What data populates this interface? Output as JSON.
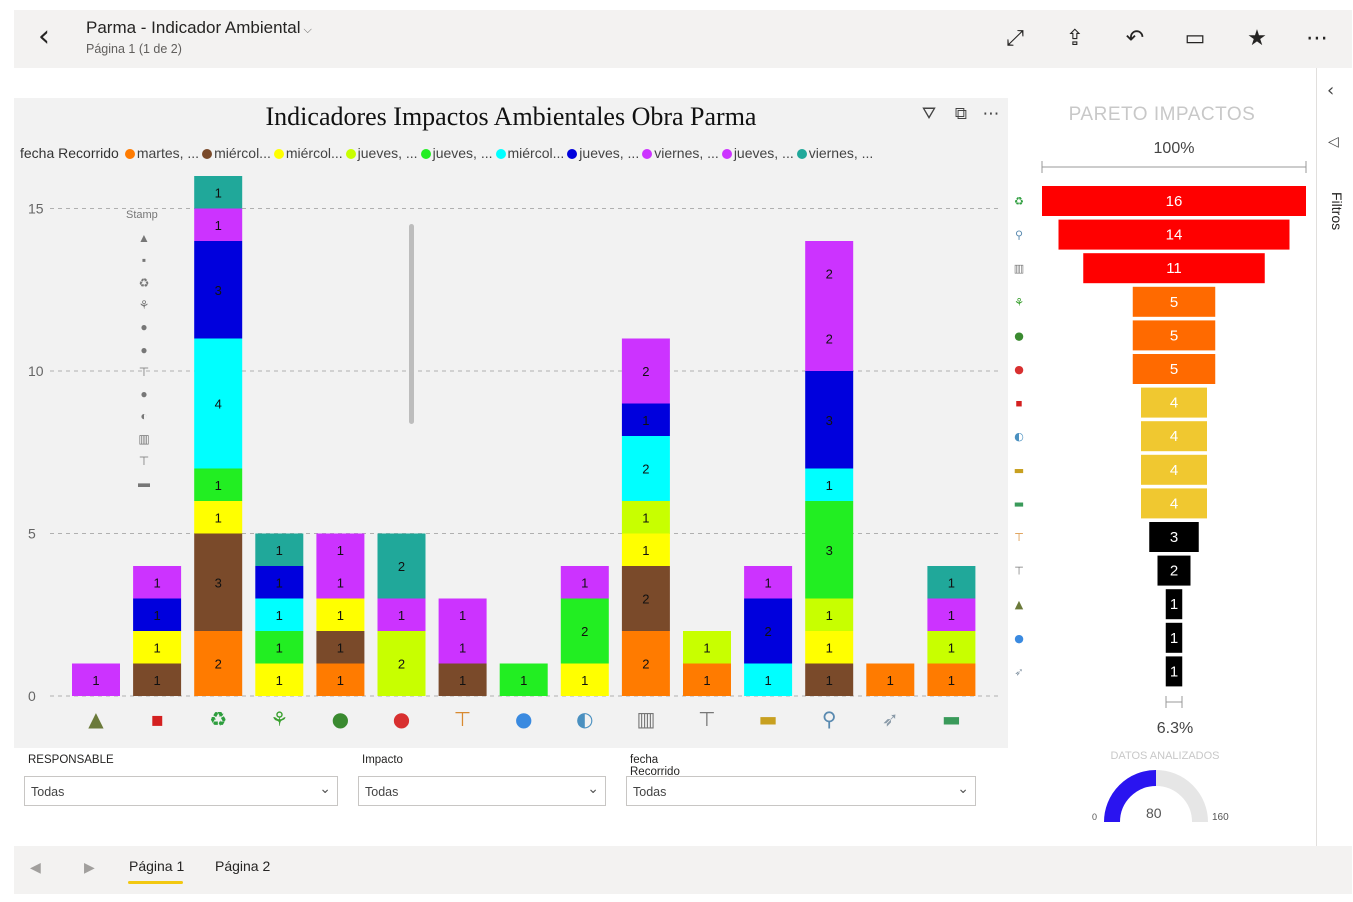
{
  "header": {
    "report_title": "Parma - Indicador Ambiental",
    "page_info": "Página 1 (1 de 2)",
    "icons": [
      "back-icon",
      "fullscreen-icon",
      "share-icon",
      "reset-icon",
      "comment-icon",
      "favorite-icon",
      "more-icon"
    ]
  },
  "visual_header": {
    "icons": [
      "filter-icon",
      "focus-mode-icon",
      "more-options-icon"
    ]
  },
  "legend": {
    "title": "fecha Recorrido",
    "items": [
      {
        "label": "martes, ...",
        "color": "#ff7b00"
      },
      {
        "label": "miércol...",
        "color": "#7a4a2a"
      },
      {
        "label": "miércol...",
        "color": "#ffff00"
      },
      {
        "label": "jueves, ...",
        "color": "#c8ff00"
      },
      {
        "label": "jueves, ...",
        "color": "#22ee22"
      },
      {
        "label": "miércol...",
        "color": "#00ffff"
      },
      {
        "label": "jueves, ...",
        "color": "#0000dd"
      },
      {
        "label": "viernes, ...",
        "color": "#cc33ff"
      },
      {
        "label": "jueves, ...",
        "color": "#cc33ff"
      },
      {
        "label": "viernes, ...",
        "color": "#20a89a"
      }
    ]
  },
  "stamp": {
    "title": "Stamp",
    "icons": [
      "mountain-icon",
      "bucket-icon",
      "recycle-icon",
      "sprout-icon",
      "tree-icon",
      "bag-icon",
      "crane-icon",
      "water-drop-icon",
      "earth-icon",
      "trash-can-icon",
      "sign-icon",
      "barrier-icon"
    ],
    "glyphs": [
      "▲",
      "▪",
      "♻",
      "⚘",
      "●",
      "●",
      "⊤",
      "●",
      "◐",
      "▥",
      "⊤",
      "▬"
    ]
  },
  "chart_data": {
    "type": "bar",
    "title": "Indicadores Impactos Ambientales Obra Parma",
    "stacked": true,
    "categories": [
      "mountain-icon",
      "bucket-icon",
      "recycle-icon",
      "sprout-icon",
      "tree-icon",
      "bag-icon",
      "crane-icon",
      "water-drop-icon",
      "earth-icon",
      "trash-can-icon",
      "sign-icon",
      "barrier-icon",
      "faucet-icon",
      "hose-icon",
      "road-icon"
    ],
    "category_glyphs": [
      "▲",
      "▪",
      "♻",
      "⚘",
      "●",
      "●",
      "⊤",
      "●",
      "◐",
      "▥",
      "⊤",
      "▬",
      "⚲",
      "➶",
      "▬"
    ],
    "category_colors": [
      "#6b7a3a",
      "#d42020",
      "#2e9e3e",
      "#3aa030",
      "#3a8a30",
      "#d83030",
      "#d88a30",
      "#3a8ae0",
      "#4a90c0",
      "#777777",
      "#777777",
      "#c8a020",
      "#5a8ab0",
      "#8a9aa8",
      "#3a9a5a"
    ],
    "yticks": [
      0,
      5,
      10,
      15
    ],
    "ylim": [
      0,
      16
    ],
    "grid": true,
    "bars": [
      [
        {
          "v": 1,
          "c": "#cc33ff"
        }
      ],
      [
        {
          "v": 1,
          "c": "#7a4a2a"
        },
        {
          "v": 1,
          "c": "#ffff00"
        },
        {
          "v": 1,
          "c": "#0000dd"
        },
        {
          "v": 1,
          "c": "#cc33ff"
        }
      ],
      [
        {
          "v": 2,
          "c": "#ff7b00"
        },
        {
          "v": 3,
          "c": "#7a4a2a"
        },
        {
          "v": 1,
          "c": "#ffff00"
        },
        {
          "v": 1,
          "c": "#22ee22"
        },
        {
          "v": 4,
          "c": "#00ffff"
        },
        {
          "v": 3,
          "c": "#0000dd"
        },
        {
          "v": 1,
          "c": "#cc33ff"
        },
        {
          "v": 1,
          "c": "#20a89a"
        }
      ],
      [
        {
          "v": 1,
          "c": "#ffff00"
        },
        {
          "v": 1,
          "c": "#22ee22"
        },
        {
          "v": 1,
          "c": "#00ffff"
        },
        {
          "v": 1,
          "c": "#0000dd"
        },
        {
          "v": 1,
          "c": "#20a89a"
        }
      ],
      [
        {
          "v": 1,
          "c": "#ff7b00"
        },
        {
          "v": 1,
          "c": "#7a4a2a"
        },
        {
          "v": 1,
          "c": "#ffff00"
        },
        {
          "v": 1,
          "c": "#cc33ff"
        },
        {
          "v": 1,
          "c": "#cc33ff"
        }
      ],
      [
        {
          "v": 2,
          "c": "#c8ff00"
        },
        {
          "v": 1,
          "c": "#cc33ff"
        },
        {
          "v": 2,
          "c": "#20a89a"
        }
      ],
      [
        {
          "v": 1,
          "c": "#7a4a2a"
        },
        {
          "v": 1,
          "c": "#cc33ff"
        },
        {
          "v": 1,
          "c": "#cc33ff"
        }
      ],
      [
        {
          "v": 1,
          "c": "#22ee22"
        }
      ],
      [
        {
          "v": 1,
          "c": "#ffff00"
        },
        {
          "v": 2,
          "c": "#22ee22"
        },
        {
          "v": 1,
          "c": "#cc33ff"
        }
      ],
      [
        {
          "v": 2,
          "c": "#ff7b00"
        },
        {
          "v": 2,
          "c": "#7a4a2a"
        },
        {
          "v": 1,
          "c": "#ffff00"
        },
        {
          "v": 1,
          "c": "#c8ff00"
        },
        {
          "v": 2,
          "c": "#00ffff"
        },
        {
          "v": 1,
          "c": "#0000dd"
        },
        {
          "v": 2,
          "c": "#cc33ff"
        }
      ],
      [
        {
          "v": 1,
          "c": "#ff7b00"
        },
        {
          "v": 1,
          "c": "#c8ff00"
        }
      ],
      [
        {
          "v": 1,
          "c": "#00ffff"
        },
        {
          "v": 2,
          "c": "#0000dd"
        },
        {
          "v": 1,
          "c": "#cc33ff"
        }
      ],
      [
        {
          "v": 1,
          "c": "#7a4a2a"
        },
        {
          "v": 1,
          "c": "#ffff00"
        },
        {
          "v": 1,
          "c": "#c8ff00"
        },
        {
          "v": 3,
          "c": "#22ee22"
        },
        {
          "v": 1,
          "c": "#00ffff"
        },
        {
          "v": 3,
          "c": "#0000dd"
        },
        {
          "v": 2,
          "c": "#cc33ff"
        },
        {
          "v": 2,
          "c": "#cc33ff"
        }
      ],
      [
        {
          "v": 1,
          "c": "#ff7b00"
        }
      ],
      [
        {
          "v": 1,
          "c": "#ff7b00"
        },
        {
          "v": 1,
          "c": "#c8ff00"
        },
        {
          "v": 1,
          "c": "#cc33ff"
        },
        {
          "v": 1,
          "c": "#20a89a"
        }
      ]
    ]
  },
  "slicers": [
    {
      "label": "RESPONSABLE",
      "value": "Todas"
    },
    {
      "label": "Impacto",
      "value": "Todas"
    },
    {
      "label": "fecha Recorrido",
      "value": "Todas"
    }
  ],
  "pareto": {
    "title": "PARETO IMPACTOS",
    "top_pct": "100%",
    "bottom_pct": "6.3%",
    "chart_data": {
      "type": "funnel",
      "values": [
        16,
        14,
        11,
        5,
        5,
        5,
        4,
        4,
        4,
        4,
        3,
        2,
        1,
        1,
        1
      ],
      "colors": [
        "#ff0000",
        "#ff0000",
        "#ff0000",
        "#ff6a00",
        "#ff6a00",
        "#ff6a00",
        "#f0c830",
        "#f0c830",
        "#f0c830",
        "#f0c830",
        "#000000",
        "#000000",
        "#000000",
        "#000000",
        "#000000"
      ],
      "label_colors": [
        "#ffffff",
        "#ffffff",
        "#ffffff",
        "#ffffff",
        "#ffffff",
        "#ffffff",
        "#ffffff",
        "#ffffff",
        "#ffffff",
        "#ffffff",
        "#ffffff",
        "#ffffff",
        "#ffffff",
        "#ffffff",
        "#ffffff"
      ],
      "category_glyphs": [
        "♻",
        "⚲",
        "▥",
        "⚘",
        "●",
        "●",
        "▪",
        "◐",
        "▬",
        "▬",
        "⊤",
        "⊤",
        "▲",
        "●",
        "➶"
      ],
      "category_colors": [
        "#2e9e3e",
        "#5a8ab0",
        "#777777",
        "#3aa030",
        "#3a8a30",
        "#d83030",
        "#d42020",
        "#4a90c0",
        "#c8a020",
        "#3a9a5a",
        "#d88a30",
        "#777777",
        "#6b7a3a",
        "#3a8ae0",
        "#8a9aa8"
      ]
    }
  },
  "gauge": {
    "title": "DATOS ANALIZADOS",
    "min": "0",
    "value": "80",
    "max": "160",
    "fill_fraction": 0.5,
    "fill_color": "#2a14f0",
    "track_color": "#e6e6e6"
  },
  "filters_pane": {
    "label": "Filtros"
  },
  "pages": [
    {
      "label": "Página 1",
      "active": true
    },
    {
      "label": "Página 2",
      "active": false
    }
  ]
}
